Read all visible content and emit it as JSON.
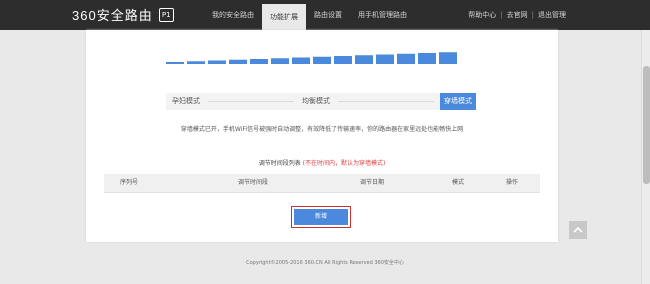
{
  "brand": {
    "name": "360安全路由",
    "badge": "P1"
  },
  "nav": {
    "tabs": [
      {
        "label": "我的安全路由"
      },
      {
        "label": "功能扩展"
      },
      {
        "label": "路由设置"
      },
      {
        "label": "用手机管理路由"
      }
    ],
    "active_index": 1
  },
  "top_links": [
    "帮助中心",
    "|",
    "去官网",
    "|",
    "退出管理"
  ],
  "signal": {
    "bars": 14,
    "accent": "#4a89dc"
  },
  "modes": {
    "left_label": "孕妇模式",
    "middle_label": "均衡模式",
    "button_label": "穿墙模式"
  },
  "description": "穿墙模式已开，手机WiFi信号被强时自动调整，有效降低了传输速率，你的路由器在家里远处也能畅快上网",
  "schedule": {
    "title": "调节时间段列表",
    "hint": "(不在时间内，默认为穿墙模式)"
  },
  "table": {
    "headers": [
      "序列号",
      "调节时间段",
      "调节日期",
      "模式",
      "操作"
    ]
  },
  "add_button_label": "新增",
  "footer": "Copyright©2005-2016 360.CN All Rights Reserved 360安全中心"
}
